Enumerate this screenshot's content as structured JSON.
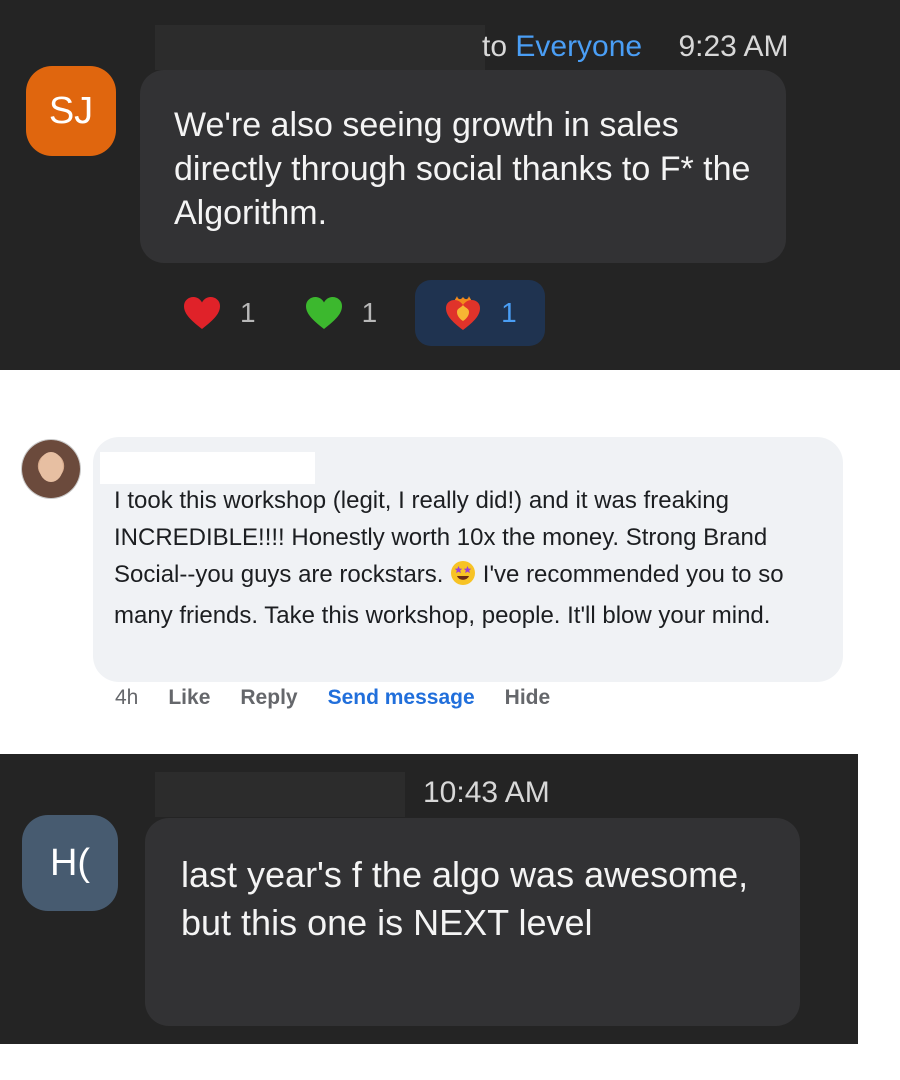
{
  "chat_message_1": {
    "to_label": "to",
    "recipient": "Everyone",
    "time": "9:23 AM",
    "avatar_initials": "SJ",
    "text": "We're also seeing growth in sales directly through social thanks to F* the Algorithm.",
    "reactions": [
      {
        "icon": "red-heart-icon",
        "count": "1",
        "selected": false
      },
      {
        "icon": "green-heart-icon",
        "count": "1",
        "selected": false
      },
      {
        "icon": "heart-on-fire-icon",
        "count": "1",
        "selected": true
      }
    ]
  },
  "comment": {
    "text_before_emoji": "I took this workshop (legit, I really did!) and it was freaking INCREDIBLE!!!! Honestly worth 10x the money. Strong Brand Social--you guys are rockstars.",
    "emoji": "star-struck-icon",
    "text_after_emoji": "I've recommended you to so many friends. Take this workshop, people. It'll blow your mind.",
    "time_ago": "4h",
    "actions": {
      "like": "Like",
      "reply": "Reply",
      "send_message": "Send message",
      "hide": "Hide"
    }
  },
  "chat_message_2": {
    "time": "10:43 AM",
    "avatar_initials": "H(",
    "text": "last year's f the algo was awesome, but this one is NEXT level"
  },
  "colors": {
    "dark_bg": "#242424",
    "bubble_dark": "#323234",
    "link_blue": "#4a9ef5",
    "sj_avatar": "#e0660e",
    "h_avatar": "#475b70",
    "comment_bg": "#f0f2f5",
    "fb_blue": "#216fdb"
  }
}
